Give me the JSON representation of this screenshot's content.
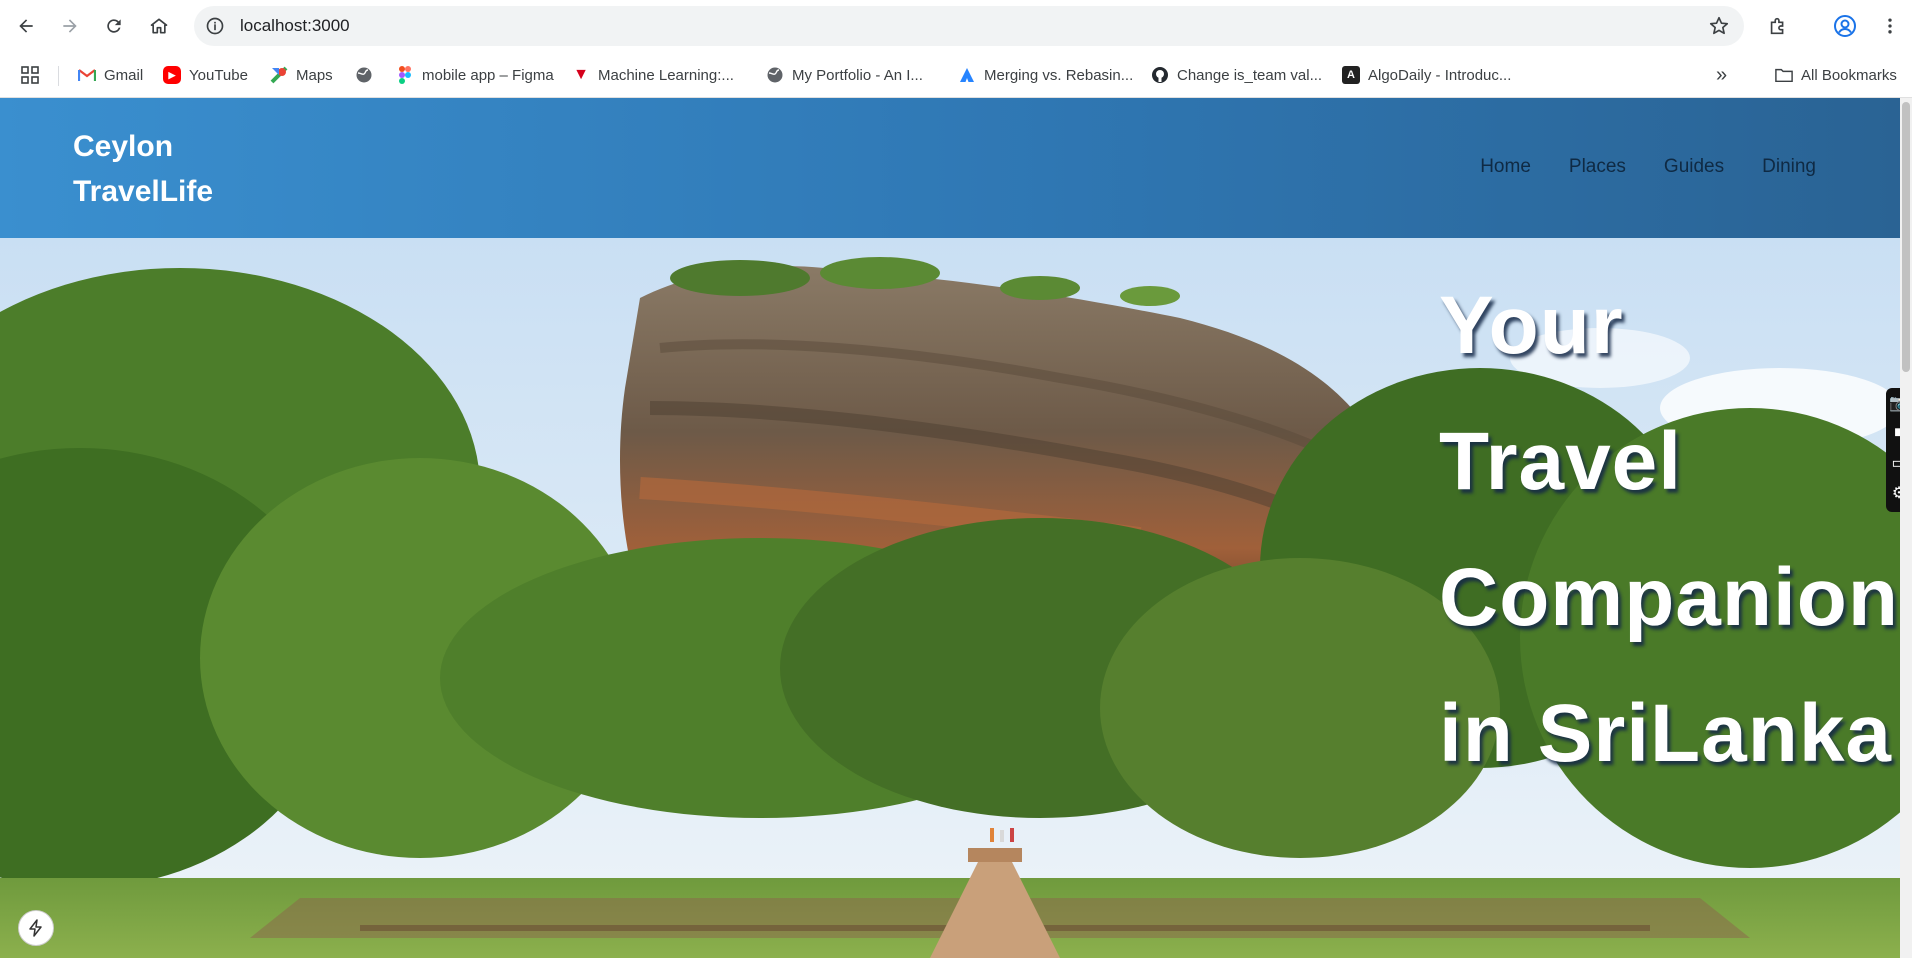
{
  "browser": {
    "url": "localhost:3000",
    "bookmarks": [
      {
        "label": "Gmail",
        "icon": "gmail-icon"
      },
      {
        "label": "YouTube",
        "icon": "youtube-icon"
      },
      {
        "label": "Maps",
        "icon": "maps-icon"
      },
      {
        "label": "",
        "icon": "globe-icon"
      },
      {
        "label": "mobile app – Figma",
        "icon": "figma-icon"
      },
      {
        "label": "Machine Learning:...",
        "icon": "udemy-icon"
      },
      {
        "label": "My Portfolio - An I...",
        "icon": "globe-icon"
      },
      {
        "label": "Merging vs. Rebasin...",
        "icon": "atlassian-icon"
      },
      {
        "label": "Change is_team val...",
        "icon": "github-icon"
      },
      {
        "label": "AlgoDaily - Introduc...",
        "icon": "algodaily-icon"
      }
    ],
    "all_bookmarks_label": "All Bookmarks"
  },
  "site": {
    "logo_line1": "Ceylon",
    "logo_line2": "TravelLife",
    "nav": [
      "Home",
      "Places",
      "Guides",
      "Dining"
    ],
    "hero_lines": [
      "Your",
      "Travel",
      "Companion",
      "in SriLanka"
    ]
  },
  "colors": {
    "header_gradient_start": "#3a8fcf",
    "header_gradient_end": "#2a6394",
    "nav_text": "#0f2a44",
    "hero_text": "#ffffff"
  }
}
